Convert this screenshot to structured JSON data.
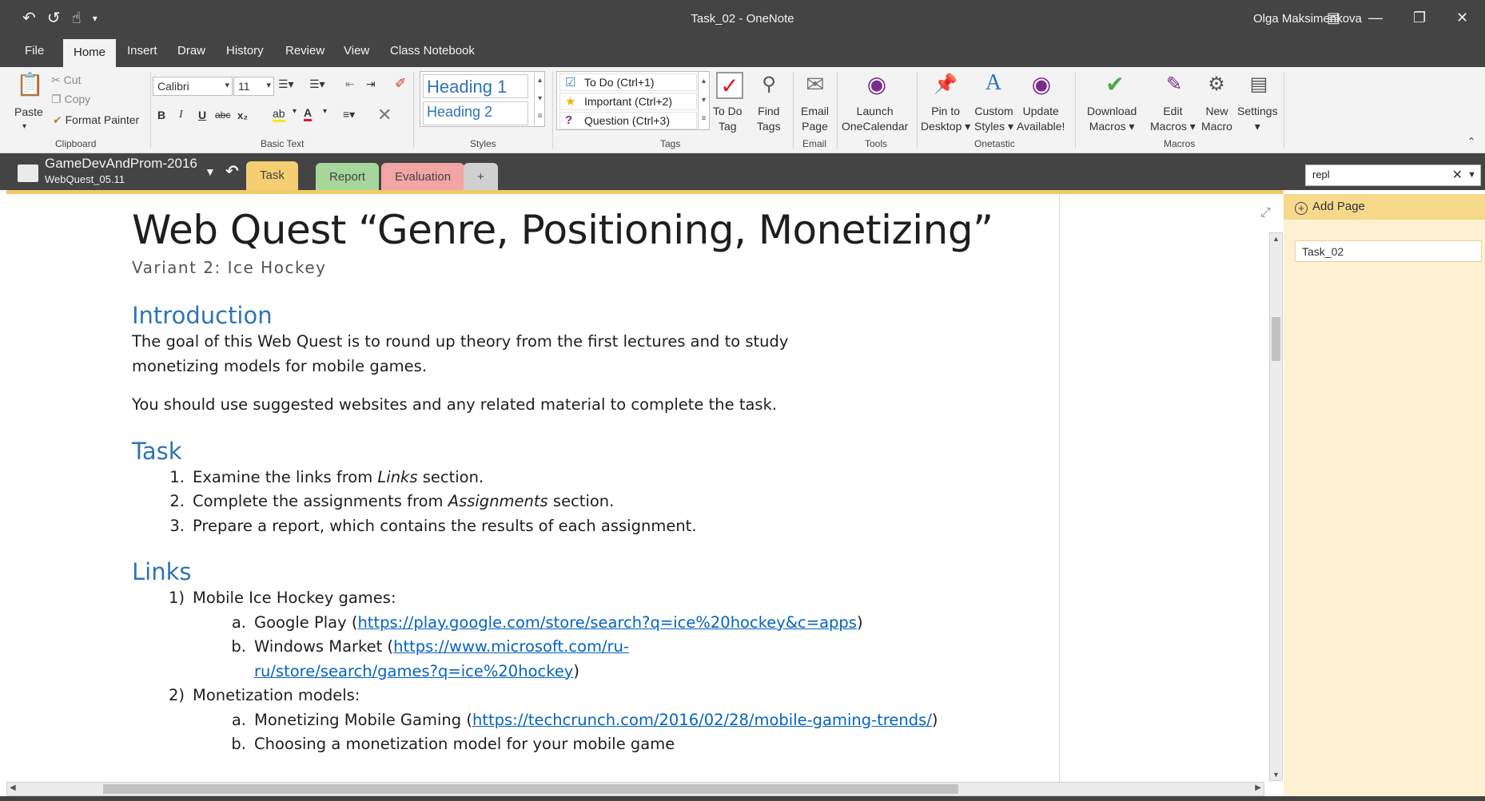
{
  "window": {
    "title": "Task_02  -  OneNote",
    "user": "Olga Maksimenkova",
    "qat_icons": [
      "back-icon",
      "undo-icon",
      "touch-mode-icon",
      "customize-icon"
    ]
  },
  "ribbon_tabs": [
    "File",
    "Home",
    "Insert",
    "Draw",
    "History",
    "Review",
    "View",
    "Class Notebook"
  ],
  "active_ribbon_tab": "Home",
  "clipboard": {
    "paste": "Paste",
    "cut": "Cut",
    "copy": "Copy",
    "format_painter": "Format Painter",
    "group": "Clipboard"
  },
  "basic_text": {
    "font": "Calibri",
    "size": "11",
    "group": "Basic Text",
    "bold": "B",
    "italic": "I",
    "underline": "U",
    "strike": "abc",
    "subscript": "x₂",
    "font_color": "A"
  },
  "styles": {
    "h1": "Heading 1",
    "h2": "Heading 2",
    "group": "Styles"
  },
  "tags": {
    "items": [
      "To Do (Ctrl+1)",
      "Important (Ctrl+2)",
      "Question (Ctrl+3)"
    ],
    "todo_tag": [
      "To Do",
      "Tag"
    ],
    "find_tags": [
      "Find",
      "Tags"
    ],
    "group": "Tags"
  },
  "email": {
    "label": [
      "Email",
      "Page"
    ],
    "group": "Email"
  },
  "tools": {
    "label": [
      "Launch",
      "OneCalendar"
    ],
    "group": "Tools"
  },
  "onetastic": {
    "pin": [
      "Pin to",
      "Desktop ▾"
    ],
    "custom": [
      "Custom",
      "Styles ▾"
    ],
    "update": [
      "Update",
      "Available!"
    ],
    "group": "Onetastic"
  },
  "macros": {
    "download": [
      "Download",
      "Macros ▾"
    ],
    "edit": [
      "Edit",
      "Macros ▾"
    ],
    "new": [
      "New",
      "Macro"
    ],
    "settings": [
      "Settings",
      "▾"
    ],
    "group": "Macros"
  },
  "notebook": {
    "name": "GameDevAndProm-2016",
    "section_group": "WebQuest_05.11"
  },
  "section_tabs": [
    {
      "label": "Task",
      "color": "#f4cf72"
    },
    {
      "label": "Report",
      "color": "#a6d69a"
    },
    {
      "label": "Evaluation",
      "color": "#f2a5a5"
    },
    {
      "label": "+",
      "color": "#d0d0d0"
    }
  ],
  "search": {
    "value": "repl"
  },
  "page": {
    "title": "Web Quest “Genre, Positioning, Monetizing”",
    "subtitle": "Variant 2: Ice Hockey",
    "intro_heading": "Introduction",
    "intro_p1": "The goal of this Web Quest is to round up theory from the first lectures and to study monetizing models for mobile games.",
    "intro_p2": "You should use suggested websites and any related material to complete the task.",
    "task_heading": "Task",
    "task_items": [
      {
        "num": "1.",
        "pre": "Examine the links from ",
        "em": "Links",
        "post": " section."
      },
      {
        "num": "2.",
        "pre": "Complete the assignments from ",
        "em": "Assignments",
        "post": " section."
      },
      {
        "num": "3.",
        "pre": "Prepare a report, which contains the results of each assignment.",
        "em": "",
        "post": ""
      }
    ],
    "links_heading": "Links",
    "links": {
      "item1": "Mobile Ice Hockey games:",
      "item1_num": "1)",
      "google_pre": "Google Play (",
      "google_url": "https://play.google.com/store/search?q=ice%20hockey&c=apps",
      "google_post": ")",
      "windows_pre": "Windows Market (",
      "windows_url_1": "https://www.microsoft.com/ru-",
      "windows_url_2": "ru/store/search/games?q=ice%20hockey",
      "windows_post": ")",
      "item2": "Monetization models:",
      "item2_num": "2)",
      "mm_pre": "Monetizing Mobile Gaming (",
      "mm_url": "https://techcrunch.com/2016/02/28/mobile-gaming-trends/",
      "mm_post": ")",
      "choose": "Choosing a monetization model for your mobile game",
      "a": "a.",
      "b": "b."
    }
  },
  "pages_pane": {
    "add_page": "Add Page",
    "pages": [
      "Task_02"
    ]
  },
  "colors": {
    "chrome": "#444444",
    "accent_heading": "#2e74b5",
    "link": "#0563c1",
    "section_task": "#f4cf72"
  }
}
